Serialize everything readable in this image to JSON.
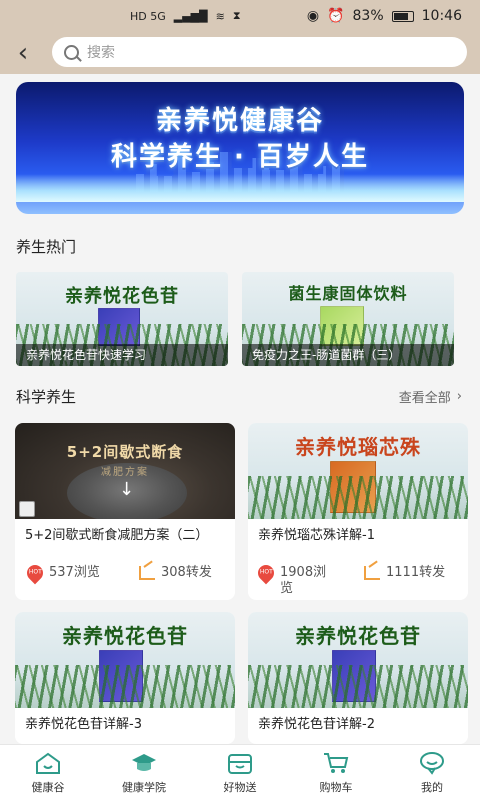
{
  "statusbar": {
    "signal": "HD 5G",
    "battery_percent": "83%",
    "time": "10:46"
  },
  "header": {
    "back_icon": "chevron-left-icon",
    "search_placeholder": "搜索"
  },
  "banner": {
    "title_line1": "亲养悦健康谷",
    "title_line2": "科学养生 · 百岁人生"
  },
  "hot_section": {
    "title": "养生热门",
    "items": [
      {
        "product_title": "亲养悦花色苷",
        "caption": "亲养悦花色苷快速学习"
      },
      {
        "product_title": "菌生康固体饮料",
        "caption": "免疫力之王-肠道菌群（三）"
      }
    ]
  },
  "science_section": {
    "title": "科学养生",
    "more_label": "查看全部",
    "items": [
      {
        "image_line1": "5+2间歇式断食",
        "image_line2": "减肥方案",
        "title": "5+2间歇式断食减肥方案（二）",
        "views": "537浏览",
        "shares": "308转发"
      },
      {
        "image_line1": "亲养悦瑙芯殊",
        "title": "亲养悦瑙芯殊详解-1",
        "views": "1908浏览",
        "shares": "1111转发"
      },
      {
        "image_line1": "亲养悦花色苷",
        "title": "亲养悦花色苷详解-3"
      },
      {
        "image_line1": "亲养悦花色苷",
        "title": "亲养悦花色苷详解-2"
      }
    ]
  },
  "tabbar": [
    {
      "label": "健康谷",
      "icon": "home-icon",
      "active": true
    },
    {
      "label": "健康学院",
      "icon": "graduation-cap-icon"
    },
    {
      "label": "好物送",
      "icon": "gift-box-icon"
    },
    {
      "label": "购物车",
      "icon": "cart-icon"
    },
    {
      "label": "我的",
      "icon": "chat-face-icon"
    }
  ],
  "colors": {
    "accent": "#2e9b8a",
    "header_bg": "#d8c9b8",
    "hot_badge": "#e84a3f",
    "share": "#f0a040",
    "title_green": "#1d5c1a",
    "title_orange": "#c9451d"
  }
}
